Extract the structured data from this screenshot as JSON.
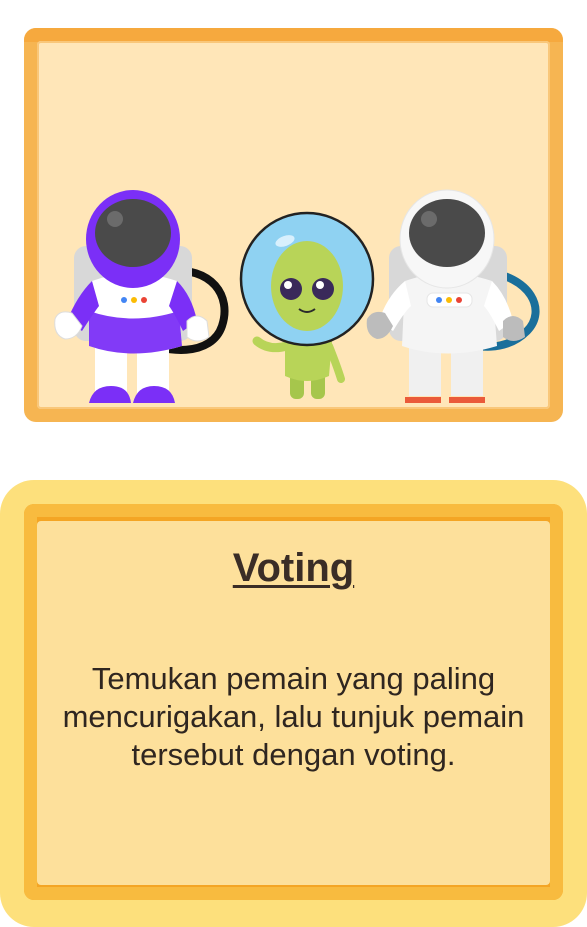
{
  "card": {
    "title": "Voting",
    "description": "Temukan pemain yang paling mencurigakan, lalu tunjuk pemain tersebut dengan voting."
  },
  "scene": {
    "characters": [
      {
        "name": "astronaut-purple-icon",
        "accent": "#7b2ff7"
      },
      {
        "name": "alien-icon",
        "accent": "#a6c64c"
      },
      {
        "name": "astronaut-white-icon",
        "accent": "#eeeeee"
      }
    ]
  },
  "colors": {
    "frame_orange": "#f6b552",
    "scene_bg": "#ffe6b8",
    "card_yellow": "#fde07c",
    "card_inner": "#fde09b"
  }
}
